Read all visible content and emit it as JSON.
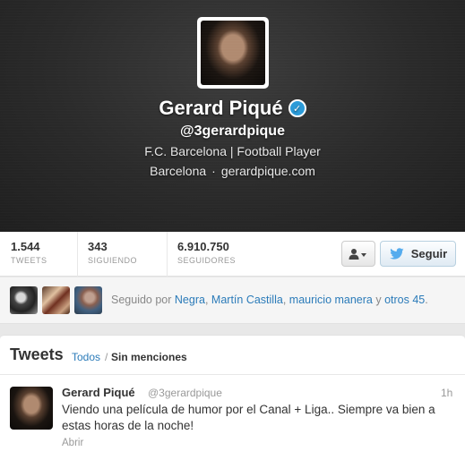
{
  "profile": {
    "name": "Gerard Piqué",
    "verified_mark": "✓",
    "handle": "@3gerardpique",
    "bio": "F.C. Barcelona | Football Player",
    "location": "Barcelona",
    "separator": "·",
    "website": "gerardpique.com"
  },
  "stats": {
    "tweets": {
      "value": "1.544",
      "label": "TWEETS"
    },
    "following": {
      "value": "343",
      "label": "SIGUIENDO"
    },
    "followers": {
      "value": "6.910.750",
      "label": "SEGUIDORES"
    }
  },
  "actions": {
    "user_menu_icon": "person-dropdown-icon",
    "follow_label": "Seguir"
  },
  "followed_by": {
    "prefix": "Seguido por",
    "users": [
      "Negra",
      "Martín Castilla",
      "mauricio manera"
    ],
    "comma": ",",
    "and": "y",
    "others": "otros 45",
    "period": "."
  },
  "tweets": {
    "title": "Tweets",
    "tab_all": "Todos",
    "tab_slash": "/",
    "tab_no_mentions": "Sin menciones",
    "items": [
      {
        "name": "Gerard Piqué",
        "handle": "@3gerardpique",
        "time": "1h",
        "text": "Viendo una película de humor por el Canal + Liga.. Siempre va bien a estas horas de la noche!",
        "open_label": "Abrir"
      }
    ]
  },
  "colors": {
    "link": "#2b7bb9",
    "verified": "#2a9ad8",
    "twitter_bird": "#55acee"
  }
}
